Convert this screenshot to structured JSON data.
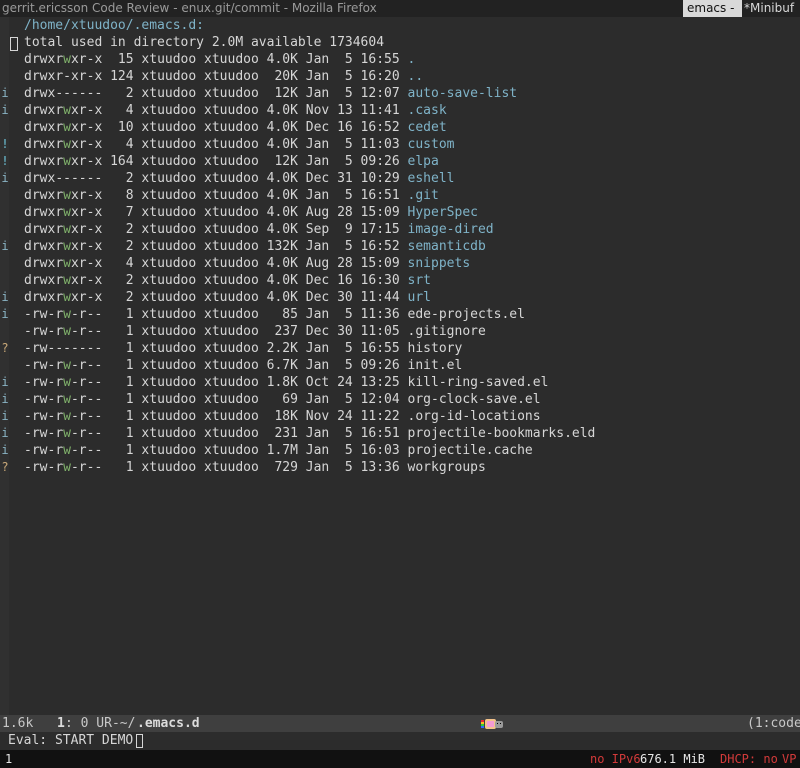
{
  "window": {
    "title": "gerrit.ericsson Code Review - enux.git/commit - Mozilla Firefox",
    "tags": {
      "active": "emacs - ",
      "inactive": "*Minibuf"
    }
  },
  "dired": {
    "header": "/home/xtuudoo/.emacs.d:",
    "total": "total used in directory 2.0M available 1734604",
    "entries": [
      {
        "perm": "drwxrwxr-x",
        "links": "15",
        "owner": "xtuudoo",
        "group": "xtuudoo",
        "size": "4.0K",
        "date": "Jan  5 16:55",
        "name": ".",
        "type": "dir",
        "mark": ""
      },
      {
        "perm": "drwxr-xr-x",
        "links": "124",
        "owner": "xtuudoo",
        "group": "xtuudoo",
        "size": "20K",
        "date": "Jan  5 16:20",
        "name": "..",
        "type": "dir",
        "mark": ""
      },
      {
        "perm": "drwx------",
        "links": "2",
        "owner": "xtuudoo",
        "group": "xtuudoo",
        "size": "12K",
        "date": "Jan  5 12:07",
        "name": "auto-save-list",
        "type": "dir",
        "mark": "i"
      },
      {
        "perm": "drwxrwxr-x",
        "links": "4",
        "owner": "xtuudoo",
        "group": "xtuudoo",
        "size": "4.0K",
        "date": "Nov 13 11:41",
        "name": ".cask",
        "type": "dir",
        "mark": "i"
      },
      {
        "perm": "drwxrwxr-x",
        "links": "10",
        "owner": "xtuudoo",
        "group": "xtuudoo",
        "size": "4.0K",
        "date": "Dec 16 16:52",
        "name": "cedet",
        "type": "dir",
        "mark": ""
      },
      {
        "perm": "drwxrwxr-x",
        "links": "4",
        "owner": "xtuudoo",
        "group": "xtuudoo",
        "size": "4.0K",
        "date": "Jan  5 11:03",
        "name": "custom",
        "type": "dir",
        "mark": "!"
      },
      {
        "perm": "drwxrwxr-x",
        "links": "164",
        "owner": "xtuudoo",
        "group": "xtuudoo",
        "size": "12K",
        "date": "Jan  5 09:26",
        "name": "elpa",
        "type": "dir",
        "mark": "!"
      },
      {
        "perm": "drwx------",
        "links": "2",
        "owner": "xtuudoo",
        "group": "xtuudoo",
        "size": "4.0K",
        "date": "Dec 31 10:29",
        "name": "eshell",
        "type": "dir",
        "mark": "i"
      },
      {
        "perm": "drwxrwxr-x",
        "links": "8",
        "owner": "xtuudoo",
        "group": "xtuudoo",
        "size": "4.0K",
        "date": "Jan  5 16:51",
        "name": ".git",
        "type": "dir",
        "mark": ""
      },
      {
        "perm": "drwxrwxr-x",
        "links": "7",
        "owner": "xtuudoo",
        "group": "xtuudoo",
        "size": "4.0K",
        "date": "Aug 28 15:09",
        "name": "HyperSpec",
        "type": "dir",
        "mark": ""
      },
      {
        "perm": "drwxrwxr-x",
        "links": "2",
        "owner": "xtuudoo",
        "group": "xtuudoo",
        "size": "4.0K",
        "date": "Sep  9 17:15",
        "name": "image-dired",
        "type": "dir",
        "mark": ""
      },
      {
        "perm": "drwxrwxr-x",
        "links": "2",
        "owner": "xtuudoo",
        "group": "xtuudoo",
        "size": "132K",
        "date": "Jan  5 16:52",
        "name": "semanticdb",
        "type": "dir",
        "mark": "i"
      },
      {
        "perm": "drwxrwxr-x",
        "links": "4",
        "owner": "xtuudoo",
        "group": "xtuudoo",
        "size": "4.0K",
        "date": "Aug 28 15:09",
        "name": "snippets",
        "type": "dir",
        "mark": ""
      },
      {
        "perm": "drwxrwxr-x",
        "links": "2",
        "owner": "xtuudoo",
        "group": "xtuudoo",
        "size": "4.0K",
        "date": "Dec 16 16:30",
        "name": "srt",
        "type": "dir",
        "mark": ""
      },
      {
        "perm": "drwxrwxr-x",
        "links": "2",
        "owner": "xtuudoo",
        "group": "xtuudoo",
        "size": "4.0K",
        "date": "Dec 30 11:44",
        "name": "url",
        "type": "dir",
        "mark": "i"
      },
      {
        "perm": "-rw-rw-r--",
        "links": "1",
        "owner": "xtuudoo",
        "group": "xtuudoo",
        "size": "85",
        "date": "Jan  5 11:36",
        "name": "ede-projects.el",
        "type": "file",
        "mark": "i"
      },
      {
        "perm": "-rw-rw-r--",
        "links": "1",
        "owner": "xtuudoo",
        "group": "xtuudoo",
        "size": "237",
        "date": "Dec 30 11:05",
        "name": ".gitignore",
        "type": "file",
        "mark": ""
      },
      {
        "perm": "-rw-------",
        "links": "1",
        "owner": "xtuudoo",
        "group": "xtuudoo",
        "size": "2.2K",
        "date": "Jan  5 16:55",
        "name": "history",
        "type": "file",
        "mark": "?"
      },
      {
        "perm": "-rw-rw-r--",
        "links": "1",
        "owner": "xtuudoo",
        "group": "xtuudoo",
        "size": "6.7K",
        "date": "Jan  5 09:26",
        "name": "init.el",
        "type": "file",
        "mark": ""
      },
      {
        "perm": "-rw-rw-r--",
        "links": "1",
        "owner": "xtuudoo",
        "group": "xtuudoo",
        "size": "1.8K",
        "date": "Oct 24 13:25",
        "name": "kill-ring-saved.el",
        "type": "file",
        "mark": "i"
      },
      {
        "perm": "-rw-rw-r--",
        "links": "1",
        "owner": "xtuudoo",
        "group": "xtuudoo",
        "size": "69",
        "date": "Jan  5 12:04",
        "name": "org-clock-save.el",
        "type": "file",
        "mark": "i"
      },
      {
        "perm": "-rw-rw-r--",
        "links": "1",
        "owner": "xtuudoo",
        "group": "xtuudoo",
        "size": "18K",
        "date": "Nov 24 11:22",
        "name": ".org-id-locations",
        "type": "file",
        "mark": "i"
      },
      {
        "perm": "-rw-rw-r--",
        "links": "1",
        "owner": "xtuudoo",
        "group": "xtuudoo",
        "size": "231",
        "date": "Jan  5 16:51",
        "name": "projectile-bookmarks.eld",
        "type": "file",
        "mark": "i"
      },
      {
        "perm": "-rw-rw-r--",
        "links": "1",
        "owner": "xtuudoo",
        "group": "xtuudoo",
        "size": "1.7M",
        "date": "Jan  5 16:03",
        "name": "projectile.cache",
        "type": "file",
        "mark": "i"
      },
      {
        "perm": "-rw-rw-r--",
        "links": "1",
        "owner": "xtuudoo",
        "group": "xtuudoo",
        "size": "729",
        "date": "Jan  5 13:36",
        "name": "workgroups",
        "type": "file",
        "mark": "?"
      }
    ]
  },
  "modeline": {
    "size": "1.6k",
    "line": "1",
    "col_state": ": 0 UR-~/",
    "buffer": ".emacs.d",
    "mode": "(1:code"
  },
  "minibuffer": {
    "text": "Eval: START DEMO"
  },
  "statusbar": {
    "workspace": "1",
    "ipv6": "no IPv6",
    "memory": "676.1 MiB",
    "dhcp": "DHCP: no",
    "vpn": "VP"
  },
  "colors": {
    "background": "#2c2c2c",
    "foreground": "#d6d6d6",
    "directory": "#7fb3c8",
    "group_write": "#7fb06a",
    "status_alert": "#d23a3a"
  }
}
